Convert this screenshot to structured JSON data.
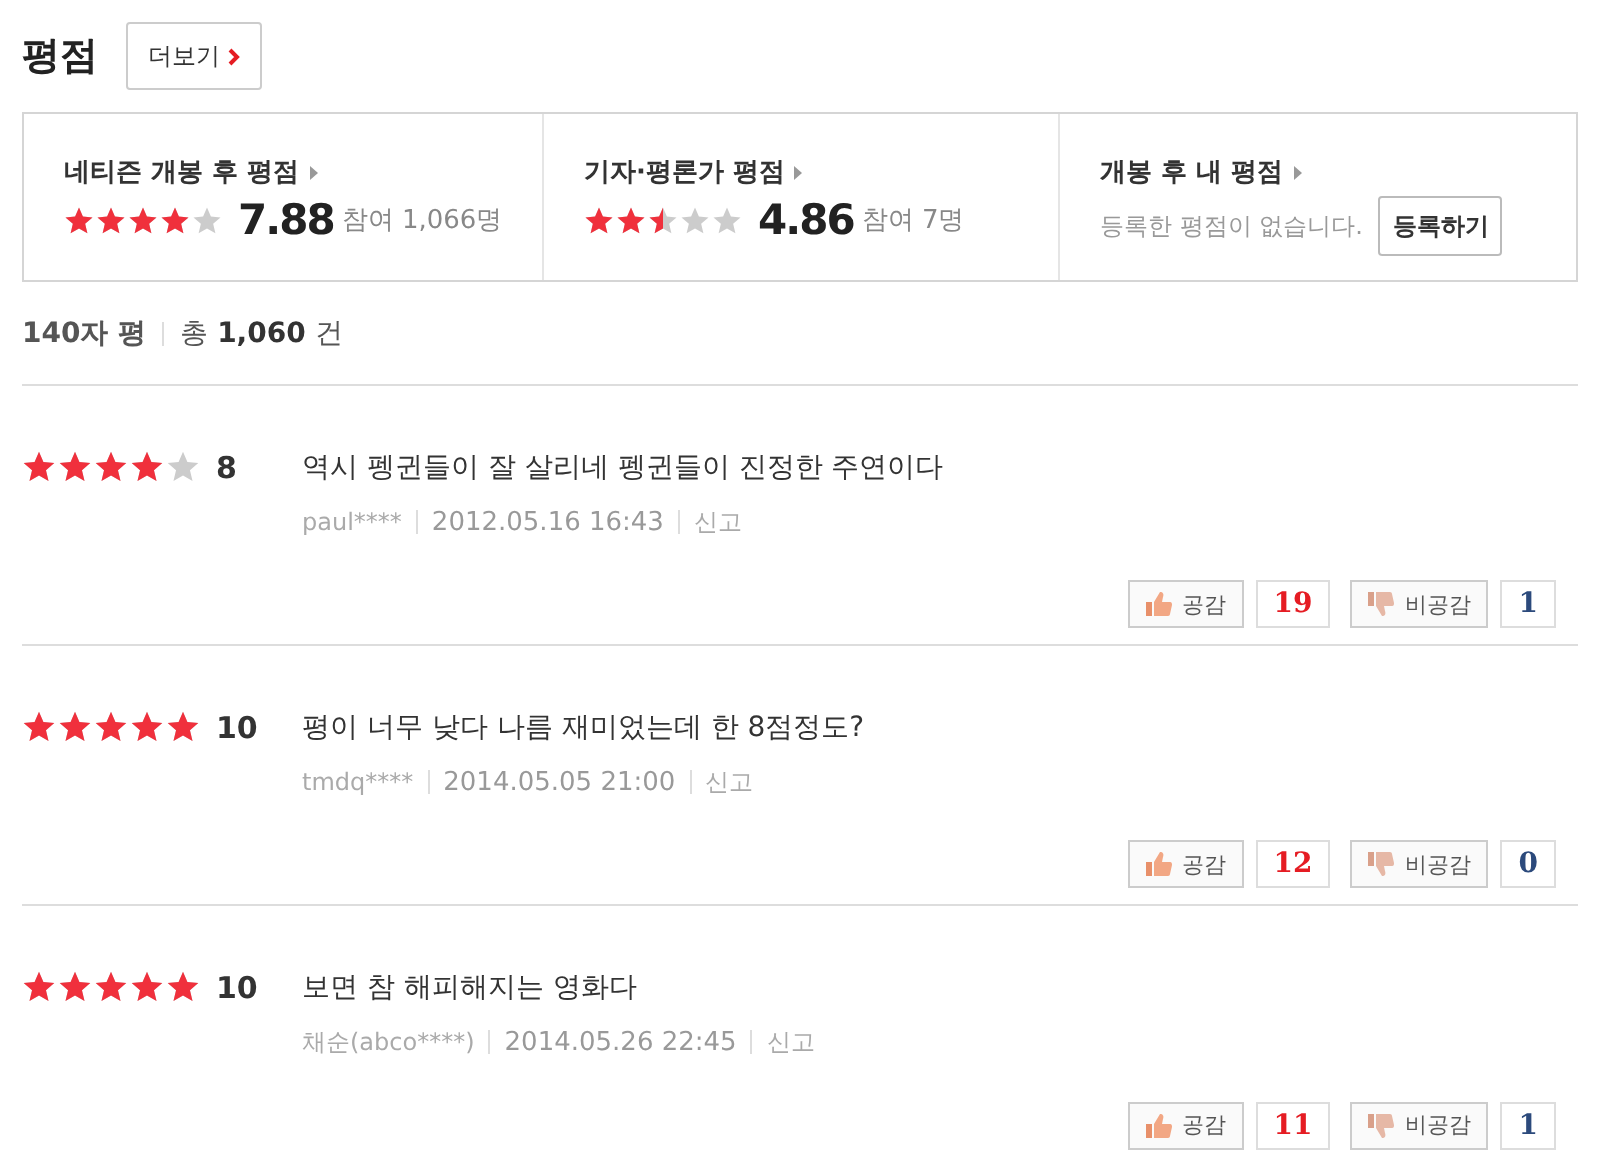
{
  "section": {
    "title": "평점",
    "more_button": "더보기"
  },
  "summary": [
    {
      "kind": "score",
      "title": "네티즌 개봉 후 평점",
      "stars": 4,
      "score": "7.88",
      "participants": "참여 1,066명"
    },
    {
      "kind": "score",
      "title": "기자·평론가 평점",
      "stars": 2.5,
      "score": "4.86",
      "participants": "참여 7명"
    },
    {
      "kind": "mine",
      "title": "개봉 후 내 평점",
      "message": "등록한 평점이 없습니다.",
      "button": "등록하기"
    }
  ],
  "count_bar": {
    "label": "140자 평",
    "total": "총 **1,060** 건"
  },
  "reviews": [
    {
      "stars": 4,
      "score": "8",
      "text": "역시 펭귄들이 잘 살리네 펭귄들이 진정한 주연이다",
      "author": "paul****",
      "date": "2012.05.16 16:43",
      "report": "신고",
      "like_label": "공감",
      "likes": "19",
      "dislike_label": "비공감",
      "dislikes": "1"
    },
    {
      "stars": 5,
      "score": "10",
      "text": "평이 너무 낮다 나름 재미었는데 한 8점정도?",
      "author": "tmdq****",
      "date": "2014.05.05 21:00",
      "report": "신고",
      "like_label": "공감",
      "likes": "12",
      "dislike_label": "비공감",
      "dislikes": "0"
    },
    {
      "stars": 5,
      "score": "10",
      "text": "보면 참 해피해지는 영화다",
      "author": "채순(abco****)",
      "date": "2014.05.26 22:45",
      "report": "신고",
      "like_label": "공감",
      "likes": "11",
      "dislike_label": "비공감",
      "dislikes": "1"
    }
  ]
}
